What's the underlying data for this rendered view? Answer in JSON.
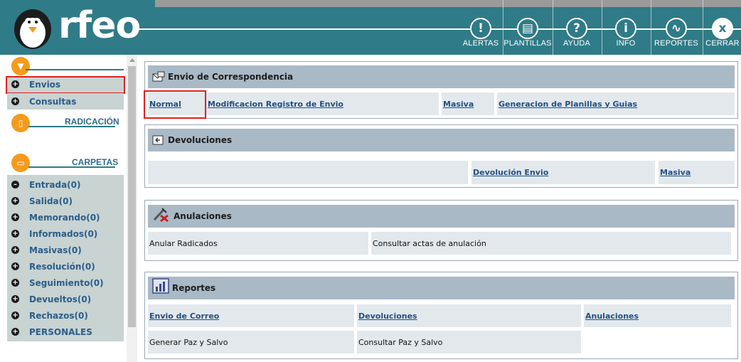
{
  "header": {
    "logo_text": "rfeo",
    "buttons": [
      {
        "label": "ALERTAS",
        "icon": "alert-icon",
        "glyph": "!"
      },
      {
        "label": "PLANTILLAS",
        "icon": "templates-icon",
        "glyph": "▤"
      },
      {
        "label": "AYUDA",
        "icon": "help-icon",
        "glyph": "?"
      },
      {
        "label": "INFO",
        "icon": "info-icon",
        "glyph": "i"
      },
      {
        "label": "REPORTES",
        "icon": "reports-icon",
        "glyph": "∿"
      },
      {
        "label": "CERRAR",
        "icon": "close-icon",
        "glyph": "x"
      }
    ]
  },
  "sidebar": {
    "top_items": [
      {
        "label": "Envios"
      },
      {
        "label": "Consultas"
      }
    ],
    "radicacion_title": "RADICACIÓN",
    "carpetas_title": "CARPETAS",
    "folders": [
      {
        "label": "Entrada(0)",
        "sign": "–"
      },
      {
        "label": "Salida(0)",
        "sign": "+"
      },
      {
        "label": "Memorando(0)",
        "sign": "+"
      },
      {
        "label": "Informados(0)",
        "sign": "+"
      },
      {
        "label": "Masivas(0)",
        "sign": "+"
      },
      {
        "label": "Resolución(0)",
        "sign": "+"
      },
      {
        "label": "Seguimiento(0)",
        "sign": "+"
      },
      {
        "label": "Devueltos(0)",
        "sign": "+"
      },
      {
        "label": "Rechazos(0)",
        "sign": "+"
      },
      {
        "label": "PERSONALES",
        "sign": "+"
      }
    ]
  },
  "envio": {
    "title": "Envio de Correspondencia",
    "links": [
      "Normal",
      "Modificacion Registro de Envio",
      "Masiva",
      "Generacion de Planillas y Guias"
    ]
  },
  "devoluciones": {
    "title": "Devoluciones",
    "links": [
      "Devolución Envio",
      "Masiva"
    ]
  },
  "anulaciones": {
    "title": "Anulaciones",
    "items": [
      "Anular Radicados",
      "Consultar actas de anulación"
    ]
  },
  "reportes": {
    "title": "Reportes",
    "links": [
      "Envio de Correo",
      "Devoluciones",
      "Anulaciones"
    ],
    "items": [
      "Generar Paz y Salvo",
      "Consultar Paz y Salvo"
    ]
  },
  "colors": {
    "header_teal": "#2f7b87",
    "accent_orange": "#f59b1c",
    "highlight_red": "#e02020",
    "link_blue": "#1f4f87"
  }
}
